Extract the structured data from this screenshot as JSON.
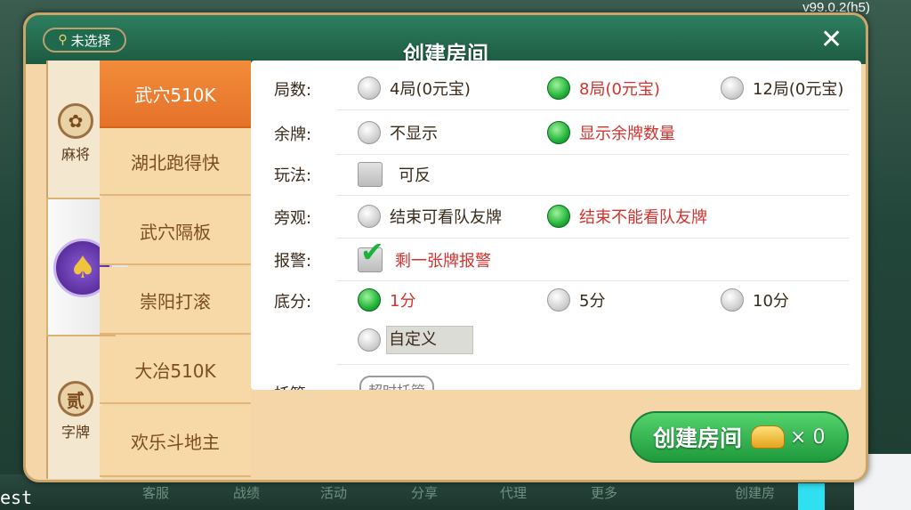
{
  "version": "v99.0.2(h5)",
  "corner_text": "est",
  "background_menu": [
    "客服",
    "战绩",
    "活动",
    "分享",
    "代理",
    "更多",
    "创建房"
  ],
  "header": {
    "title": "创建房间",
    "location_label": "未选择"
  },
  "game_types": [
    {
      "label": "麻将",
      "emblem": "✿"
    },
    {
      "label": "",
      "emblem": "♠"
    },
    {
      "label": "字牌",
      "emblem": "贰"
    }
  ],
  "games": [
    "武穴510K",
    "湖北跑得快",
    "武穴隔板",
    "崇阳打滚",
    "大冶510K",
    "欢乐斗地主"
  ],
  "options": {
    "rounds": {
      "label": "局数:",
      "choices": [
        {
          "text": "4局(0元宝)",
          "selected": false
        },
        {
          "text": "8局(0元宝)",
          "selected": true
        },
        {
          "text": "12局(0元宝)",
          "selected": false
        }
      ]
    },
    "remaining": {
      "label": "余牌:",
      "choices": [
        {
          "text": "不显示",
          "selected": false
        },
        {
          "text": "显示余牌数量",
          "selected": true
        }
      ]
    },
    "play": {
      "label": "玩法:",
      "checkbox_text": "可反",
      "checked": false
    },
    "spectate": {
      "label": "旁观:",
      "choices": [
        {
          "text": "结束可看队友牌",
          "selected": false
        },
        {
          "text": "结束不能看队友牌",
          "selected": true
        }
      ]
    },
    "alarm": {
      "label": "报警:",
      "checkbox_text": "剩一张牌报警",
      "checked": true
    },
    "base_score": {
      "label": "底分:",
      "choices": [
        {
          "text": "1分",
          "selected": true
        },
        {
          "text": "5分",
          "selected": false
        },
        {
          "text": "10分",
          "selected": false
        }
      ],
      "custom_text": "自定义"
    },
    "trustee": {
      "label": "托管:",
      "button_text": "超时托管"
    }
  },
  "create_button": {
    "label": "创建房间",
    "cost": "× 0"
  },
  "colors": {
    "accent_green": "#22b33a",
    "selected_red": "#d2322e",
    "active_tab": "#e6722a"
  }
}
